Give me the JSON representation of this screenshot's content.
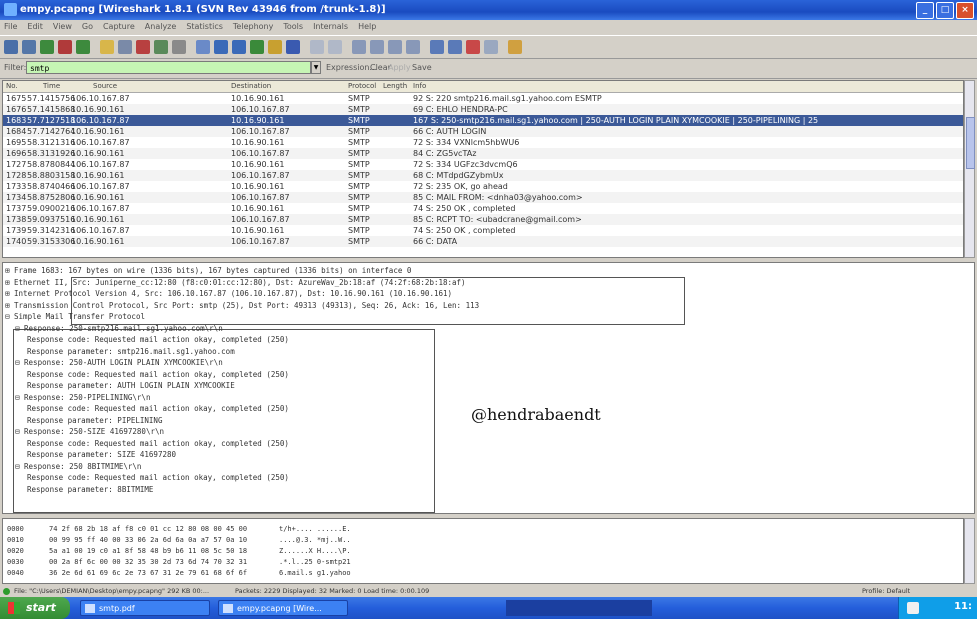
{
  "window": {
    "title": "empy.pcapng [Wireshark 1.8.1 (SVN Rev 43946 from /trunk-1.8)]"
  },
  "menu": [
    "File",
    "Edit",
    "View",
    "Go",
    "Capture",
    "Analyze",
    "Statistics",
    "Telephony",
    "Tools",
    "Internals",
    "Help"
  ],
  "filter": {
    "label": "Filter:",
    "value": "smtp",
    "expression": "Expression...",
    "clear": "Clear",
    "apply": "Apply",
    "save": "Save"
  },
  "packet_list": {
    "columns": [
      "No.",
      "Time",
      "Source",
      "Destination",
      "Protocol",
      "Length",
      "Info"
    ],
    "rows": [
      {
        "no": "1675",
        "time": "57.1415756",
        "src": "106.10.167.87",
        "dst": "10.16.90.161",
        "proto": "SMTP",
        "len": "",
        "info": "92 S: 220 smtp216.mail.sg1.yahoo.com ESMTP"
      },
      {
        "no": "1676",
        "time": "57.1415868",
        "src": "10.16.90.161",
        "dst": "106.10.167.87",
        "proto": "SMTP",
        "len": "",
        "info": "69 C: EHLO HENDRA-PC"
      },
      {
        "no": "1683",
        "time": "57.7127518",
        "src": "106.10.167.87",
        "dst": "10.16.90.161",
        "proto": "SMTP",
        "len": "",
        "info": "167 S: 250-smtp216.mail.sg1.yahoo.com | 250-AUTH LOGIN PLAIN XYMCOOKIE | 250-PIPELINING | 25"
      },
      {
        "no": "1684",
        "time": "57.7142764",
        "src": "10.16.90.161",
        "dst": "106.10.167.87",
        "proto": "SMTP",
        "len": "",
        "info": "66 C: AUTH LOGIN"
      },
      {
        "no": "1695",
        "time": "58.3121316",
        "src": "106.10.167.87",
        "dst": "10.16.90.161",
        "proto": "SMTP",
        "len": "",
        "info": "72 S: 334 VXNlcm5hbWU6"
      },
      {
        "no": "1696",
        "time": "58.3131926",
        "src": "10.16.90.161",
        "dst": "106.10.167.87",
        "proto": "SMTP",
        "len": "",
        "info": "84 C: ZG5vcTAz"
      },
      {
        "no": "1727",
        "time": "58.8780844",
        "src": "106.10.167.87",
        "dst": "10.16.90.161",
        "proto": "SMTP",
        "len": "",
        "info": "72 S: 334 UGFzc3dvcmQ6"
      },
      {
        "no": "1728",
        "time": "58.8803158",
        "src": "10.16.90.161",
        "dst": "106.10.167.87",
        "proto": "SMTP",
        "len": "",
        "info": "68 C: MTdpdGZybmUx"
      },
      {
        "no": "1733",
        "time": "58.8740466",
        "src": "106.10.167.87",
        "dst": "10.16.90.161",
        "proto": "SMTP",
        "len": "",
        "info": "72 S: 235 OK, go ahead"
      },
      {
        "no": "1734",
        "time": "58.8752806",
        "src": "10.16.90.161",
        "dst": "106.10.167.87",
        "proto": "SMTP",
        "len": "",
        "info": "85 C: MAIL FROM: <dnha03@yahoo.com>"
      },
      {
        "no": "1737",
        "time": "59.0900216",
        "src": "106.10.167.87",
        "dst": "10.16.90.161",
        "proto": "SMTP",
        "len": "",
        "info": "74 S: 250 OK , completed"
      },
      {
        "no": "1738",
        "time": "59.0937516",
        "src": "10.16.90.161",
        "dst": "106.10.167.87",
        "proto": "SMTP",
        "len": "",
        "info": "85 C: RCPT TO: <ubadcrane@gmail.com>"
      },
      {
        "no": "1739",
        "time": "59.3142316",
        "src": "106.10.167.87",
        "dst": "10.16.90.161",
        "proto": "SMTP",
        "len": "",
        "info": "74 S: 250 OK , completed"
      },
      {
        "no": "1740",
        "time": "59.3153306",
        "src": "10.16.90.161",
        "dst": "106.10.167.87",
        "proto": "SMTP",
        "len": "",
        "info": "66 C: DATA"
      }
    ]
  },
  "details": {
    "lines": [
      "⊞ Frame 1683: 167 bytes on wire (1336 bits), 167 bytes captured (1336 bits) on interface 0",
      "⊞ Ethernet II, Src: Juniperne_cc:12:80 (f8:c0:01:cc:12:80), Dst: AzureWav_2b:18:af (74:2f:68:2b:18:af)",
      "⊞ Internet Protocol Version 4, Src: 106.10.167.87 (106.10.167.87), Dst: 10.16.90.161 (10.16.90.161)",
      "⊞ Transmission Control Protocol, Src Port: smtp (25), Dst Port: 49313 (49313), Seq: 26, Ack: 16, Len: 113",
      "⊟ Simple Mail Transfer Protocol",
      "⊟ Response: 250-smtp216.mail.sg1.yahoo.com\\r\\n",
      "Response code: Requested mail action okay, completed (250)",
      "Response parameter: smtp216.mail.sg1.yahoo.com",
      "⊟ Response: 250-AUTH LOGIN PLAIN XYMCOOKIE\\r\\n",
      "Response code: Requested mail action okay, completed (250)",
      "Response parameter: AUTH LOGIN PLAIN XYMCOOKIE",
      "⊟ Response: 250-PIPELINING\\r\\n",
      "Response code: Requested mail action okay, completed (250)",
      "Response parameter: PIPELINING",
      "⊟ Response: 250-SIZE 41697280\\r\\n",
      "Response code: Requested mail action okay, completed (250)",
      "Response parameter: SIZE 41697280",
      "⊟ Response: 250 8BITMIME\\r\\n",
      "Response code: Requested mail action okay, completed (250)",
      "Response parameter: 8BITMIME"
    ],
    "watermark": "@hendrabaendt"
  },
  "hex": [
    {
      "off": "0000",
      "bytes": "74 2f 68 2b 18 af f8 c0  01 cc 12 80 08 00 45 00",
      "ascii": "t/h+.... ......E."
    },
    {
      "off": "0010",
      "bytes": "00 99 95 ff 40 00 33 06  2a 6d 6a 0a a7 57 0a 10",
      "ascii": "....@.3. *mj..W.."
    },
    {
      "off": "0020",
      "bytes": "5a a1 00 19 c0 a1 8f 58  48 b9 b6 11 08 5c 50 18",
      "ascii": "Z......X H....\\P."
    },
    {
      "off": "0030",
      "bytes": "00 2a 8f 6c 00 00 32 35  30 2d 73 6d 74 70 32 31",
      "ascii": ".*.l..25 0-smtp21"
    },
    {
      "off": "0040",
      "bytes": "36 2e 6d 61 69 6c 2e 73  67 31 2e 79 61 68 6f 6f",
      "ascii": "6.mail.s g1.yahoo"
    }
  ],
  "status": {
    "file": "File: \"C:\\Users\\DEMIAN\\Desktop\\empy.pcapng\" 292 KB 00:...",
    "packets": "Packets: 2229 Displayed: 32 Marked: 0 Load time: 0:00.109",
    "profile": "Profile: Default"
  },
  "taskbar": {
    "start": "start",
    "tasks": [
      "smtp.pdf",
      "empy.pcapng [Wire..."
    ],
    "clock": "11:"
  },
  "colors": {
    "title": "#1a4bc0",
    "selected_row": "#3b5998",
    "filter_ok": "#c6f5b4",
    "taskbar": "#245edb",
    "start": "#338c33"
  }
}
